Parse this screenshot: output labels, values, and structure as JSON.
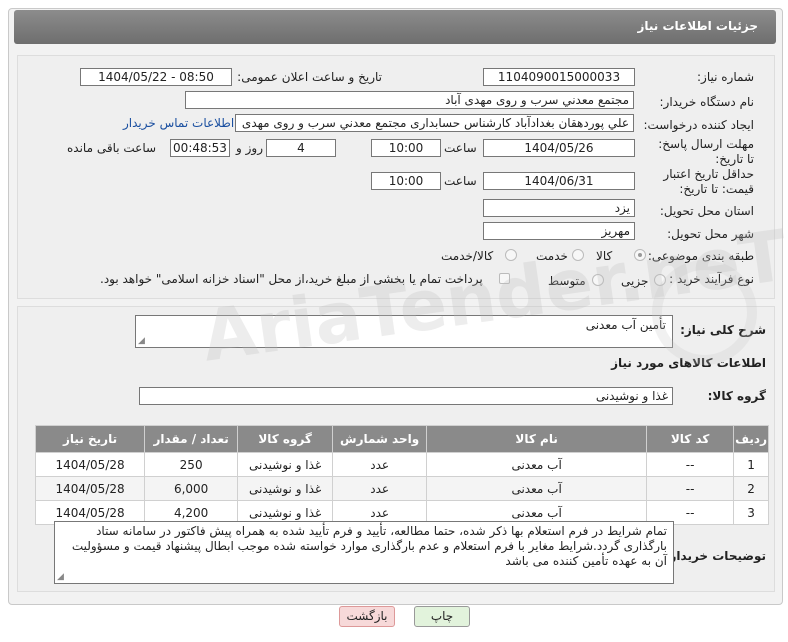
{
  "header": {
    "title": "جزئیات اطلاعات نیاز"
  },
  "form": {
    "need_number": {
      "label": "شماره نیاز:",
      "value": "1104090015000033"
    },
    "announce_datetime": {
      "label": "تاریخ و ساعت اعلان عمومی:",
      "value": "1404/05/22 - 08:50"
    },
    "buyer_org": {
      "label": "نام دستگاه خریدار:",
      "value": "مجتمع معدني سرب و روی مهدی آباد"
    },
    "requester": {
      "label": "ایجاد کننده درخواست:",
      "value": "علي پوردهقان بغدادآباد کارشناس حسابداری مجتمع معدني سرب و روی مهدی",
      "contact_link": "اطلاعات تماس خریدار"
    },
    "reply_deadline": {
      "label": "مهلت ارسال پاسخ: تا تاریخ:",
      "date": "1404/05/26",
      "time_label": "ساعت",
      "time": "10:00",
      "days": "4",
      "days_label": "روز و",
      "remaining": "00:48:53",
      "remaining_label": "ساعت باقی مانده"
    },
    "price_validity": {
      "label": "حداقل تاریخ اعتبار قیمت: تا تاریخ:",
      "date": "1404/06/31",
      "time_label": "ساعت",
      "time": "10:00"
    },
    "province": {
      "label": "استان محل تحویل:",
      "value": "یزد"
    },
    "city": {
      "label": "شهر محل تحویل:",
      "value": "مهریز"
    },
    "category": {
      "label": "طبقه بندی موضوعی:",
      "options": [
        "کالا",
        "خدمت",
        "کالا/خدمت"
      ],
      "selected": "کالا"
    },
    "process_type": {
      "label": "نوع فرآیند خرید :",
      "options": [
        "جزیی",
        "متوسط"
      ],
      "payment_note": "پرداخت تمام یا بخشی از مبلغ خرید،از محل \"اسناد خزانه اسلامی\" خواهد بود."
    }
  },
  "details": {
    "summary_label": "شرح کلی نیاز:",
    "summary_value": "تأمین آب معدنی",
    "goods_info_title": "اطلاعات کالاهای مورد نیاز",
    "goods_group_label": "گروه کالا:",
    "goods_group_value": "غذا و نوشیدنی",
    "table": {
      "headers": [
        "ردیف",
        "کد کالا",
        "نام کالا",
        "واحد شمارش",
        "گروه کالا",
        "تعداد / مقدار",
        "تاریخ نیاز"
      ],
      "rows": [
        [
          "1",
          "--",
          "آب معدنی",
          "عدد",
          "غذا و نوشیدنی",
          "250",
          "1404/05/28"
        ],
        [
          "2",
          "--",
          "آب معدنی",
          "عدد",
          "غذا و نوشیدنی",
          "6,000",
          "1404/05/28"
        ],
        [
          "3",
          "--",
          "آب معدنی",
          "عدد",
          "غذا و نوشیدنی",
          "4,200",
          "1404/05/28"
        ]
      ]
    },
    "buyer_notes_label": "توضیحات خریدار:",
    "buyer_notes_value": "تمام شرایط در فرم استعلام بها ذکر شده، حتما مطالعه، تأیید و فرم تأیید شده به همراه پیش فاکتور در سامانه ستاد بارگذاری گردد.شرایط مغایر با فرم استعلام و عدم بارگذاری موارد خواسته شده موجب ابطال پیشنهاد قیمت و مسؤولیت آن به عهده تأمین کننده می باشد"
  },
  "buttons": {
    "print": "چاپ",
    "back": "بازگشت"
  },
  "watermark": "AriaTender.neT",
  "colors": {
    "header_bg": "#7d7d7d",
    "back_button_bg": "#f7d9d9",
    "print_button_bg": "#e2f3dc",
    "link": "#1a4fa0"
  }
}
